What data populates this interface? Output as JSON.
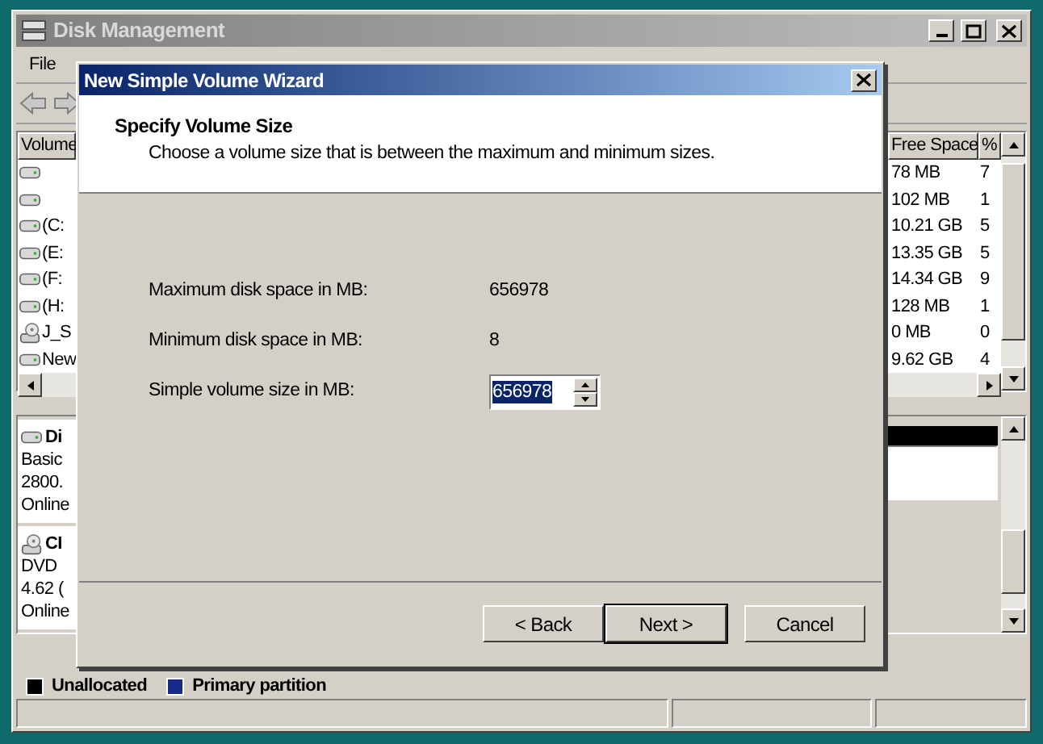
{
  "window": {
    "title": "Disk Management"
  },
  "menu": [
    "File"
  ],
  "volume_list": {
    "columns": [
      "Volume",
      "Free Space",
      "%"
    ],
    "rows": [
      {
        "volume": "",
        "kind": "disk",
        "free_space": "78 MB",
        "percent": "7"
      },
      {
        "volume": "",
        "kind": "disk",
        "free_space": "102 MB",
        "percent": "1"
      },
      {
        "volume": "(C:",
        "kind": "disk",
        "free_space": "10.21 GB",
        "percent": "5"
      },
      {
        "volume": "(E:",
        "kind": "disk",
        "free_space": "13.35 GB",
        "percent": "5"
      },
      {
        "volume": "(F:",
        "kind": "disk",
        "free_space": "14.34 GB",
        "percent": "9"
      },
      {
        "volume": "(H:",
        "kind": "disk",
        "free_space": "128 MB",
        "percent": "1"
      },
      {
        "volume": "J_S",
        "kind": "cd",
        "free_space": "0 MB",
        "percent": "0"
      },
      {
        "volume": "New",
        "kind": "disk",
        "free_space": "9.62 GB",
        "percent": "4"
      }
    ]
  },
  "disks": [
    {
      "name": "Di",
      "kind": "disk",
      "lines": [
        "Basic",
        "2800.",
        "Online"
      ]
    },
    {
      "name": "CI",
      "kind": "cd",
      "lines": [
        "DVD",
        "4.62 (",
        "Online"
      ]
    }
  ],
  "legend": [
    {
      "label": "Unallocated",
      "color": "#000000"
    },
    {
      "label": "Primary partition",
      "color": "#1a2a8c"
    }
  ],
  "dialog": {
    "title": "New Simple Volume Wizard",
    "heading": "Specify Volume Size",
    "subtitle": "Choose a volume size that is between the maximum and minimum sizes.",
    "fields": [
      {
        "kind": "value",
        "label": "Maximum disk space in MB:",
        "value": "656978"
      },
      {
        "kind": "value",
        "label": "Minimum disk space in MB:",
        "value": "8"
      },
      {
        "kind": "spin",
        "label": "Simple volume size in MB:",
        "value": "656978",
        "selected": true
      }
    ],
    "buttons": [
      {
        "label": "< Back",
        "default": false
      },
      {
        "label": "Next >",
        "default": true
      },
      {
        "label": "Cancel",
        "default": false
      }
    ]
  }
}
